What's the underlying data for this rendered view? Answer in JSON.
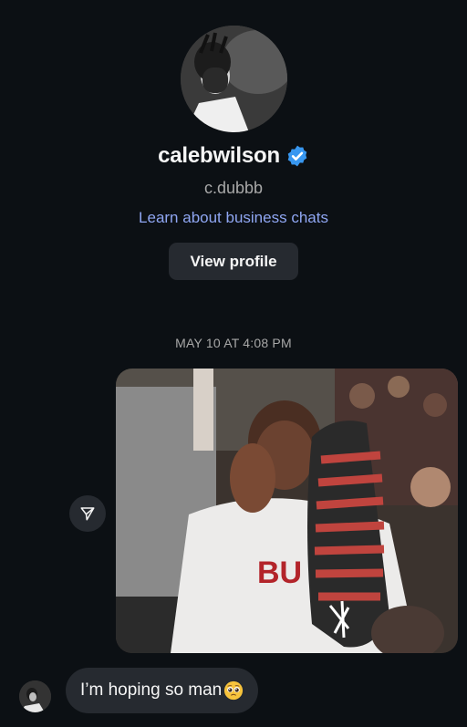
{
  "profile": {
    "username": "calebwilson",
    "verified": true,
    "handle": "c.dubbb",
    "business_link": "Learn about business chats",
    "view_profile_label": "View profile",
    "avatar_icon": "profile-photo"
  },
  "thread": {
    "timestamp": "MAY 10 AT 4:08 PM",
    "messages": [
      {
        "type": "gif",
        "icon": "basketball-gif"
      },
      {
        "type": "text",
        "text": "I’m hoping so man",
        "emoji": "pleading-face"
      }
    ]
  },
  "colors": {
    "background": "#0c1014",
    "bubble": "#262a30",
    "link": "#8fa6f2",
    "verified": "#3897f0",
    "muted_text": "#a8a8a8"
  }
}
